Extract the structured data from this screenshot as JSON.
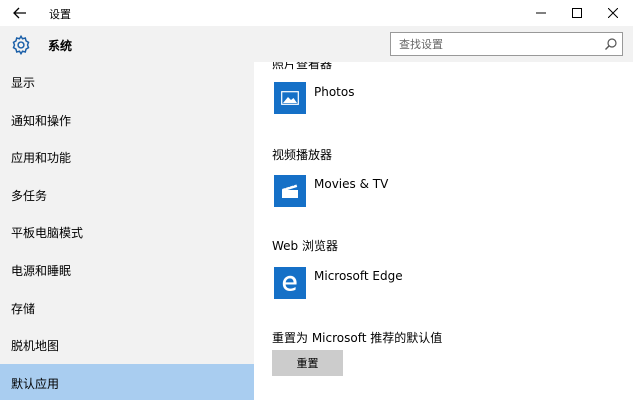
{
  "window": {
    "title": "设置",
    "back_icon": "back-arrow-icon",
    "controls": [
      "minimize-icon",
      "maximize-icon",
      "close-icon"
    ]
  },
  "sidebar": {
    "section_title": "系统",
    "section_icon": "gear-icon",
    "items": [
      {
        "label": "显示"
      },
      {
        "label": "通知和操作"
      },
      {
        "label": "应用和功能"
      },
      {
        "label": "多任务"
      },
      {
        "label": "平板电脑模式"
      },
      {
        "label": "电源和睡眠"
      },
      {
        "label": "存储"
      },
      {
        "label": "脱机地图"
      },
      {
        "label": "默认应用",
        "active": true
      }
    ],
    "active_color": "#a9cdf0"
  },
  "search": {
    "placeholder": "查找设置"
  },
  "content": {
    "photo_section_heading_partial": "照片查看器",
    "photo_app": {
      "name": "Photos",
      "icon": "photos-icon"
    },
    "video_heading": "视频播放器",
    "video_app": {
      "name": "Movies & TV",
      "icon": "movies-tv-icon"
    },
    "web_heading": "Web 浏览器",
    "web_app": {
      "name": "Microsoft Edge",
      "icon": "edge-icon"
    },
    "reset_heading": "重置为 Microsoft 推荐的默认值",
    "reset_button": "重置",
    "tile_color": "#1570c7"
  }
}
